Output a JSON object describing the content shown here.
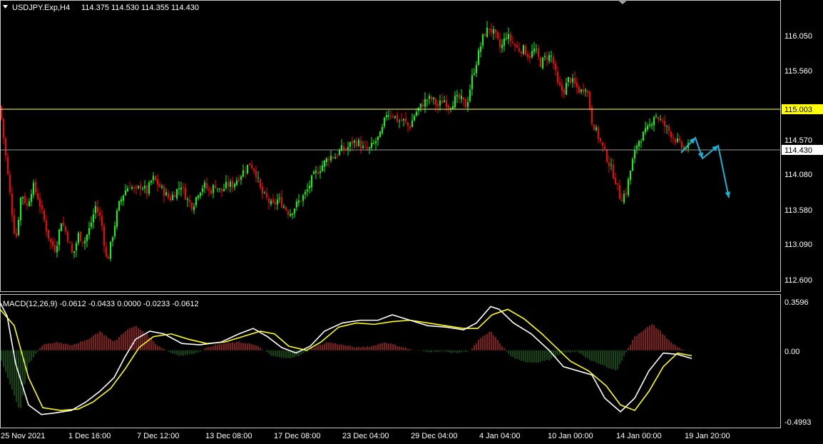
{
  "main_window": {
    "symbol_header": "USDJPY.Exp,H4",
    "ohlc": "114.375 114.530 114.355 114.430",
    "price_axis_labels": [
      "116.050",
      "115.560",
      "115.003",
      "114.570",
      "114.430",
      "114.080",
      "113.580",
      "113.090",
      "112.600"
    ],
    "hline_price": "115.003",
    "last_price": "114.430"
  },
  "macd_window": {
    "header": "MACD(12,26,9) -0.0612 -0.0433 0.0000 -0.0233 -0.0612",
    "axis_labels": [
      "0.3596",
      "0.00",
      "-0.4993"
    ]
  },
  "time_axis": {
    "labels": [
      "25 Nov 2021",
      "1 Dec 16:00",
      "7 Dec 12:00",
      "13 Dec 08:00",
      "17 Dec 08:00",
      "23 Dec 04:00",
      "29 Dec 04:00",
      "4 Jan 04:00",
      "10 Jan 00:00",
      "14 Jan 00:00",
      "19 Jan 20:00"
    ]
  },
  "colors": {
    "bull": "#00ff00",
    "bear": "#ff0000",
    "hline": "#ffff80",
    "macd_line": "#ffffff",
    "signal_line": "#ffff00",
    "hist_pos": "#ff3b3b",
    "hist_neg": "#1f8f1f",
    "forecast_arrow": "#19b4d6"
  },
  "chart_data": {
    "type": "candlestick",
    "symbol": "USDJPY.Exp",
    "timeframe": "H4",
    "ylim": [
      112.45,
      116.45
    ],
    "close_path": [
      [
        0,
        115.0
      ],
      [
        8,
        114.3
      ],
      [
        16,
        113.6
      ],
      [
        22,
        113.1
      ],
      [
        30,
        113.8
      ],
      [
        38,
        113.6
      ],
      [
        46,
        113.9
      ],
      [
        54,
        113.7
      ],
      [
        62,
        113.4
      ],
      [
        70,
        113.1
      ],
      [
        78,
        113.0
      ],
      [
        86,
        113.4
      ],
      [
        94,
        113.2
      ],
      [
        102,
        112.9
      ],
      [
        110,
        113.2
      ],
      [
        118,
        113.1
      ],
      [
        126,
        113.3
      ],
      [
        134,
        113.6
      ],
      [
        142,
        113.4
      ],
      [
        150,
        112.8
      ],
      [
        158,
        113.2
      ],
      [
        166,
        113.6
      ],
      [
        174,
        113.8
      ],
      [
        182,
        113.9
      ],
      [
        190,
        113.8
      ],
      [
        198,
        113.9
      ],
      [
        206,
        113.8
      ],
      [
        214,
        114.0
      ],
      [
        222,
        113.9
      ],
      [
        230,
        113.8
      ],
      [
        238,
        113.7
      ],
      [
        246,
        113.8
      ],
      [
        254,
        113.9
      ],
      [
        262,
        113.7
      ],
      [
        270,
        113.6
      ],
      [
        278,
        113.8
      ],
      [
        286,
        113.9
      ],
      [
        294,
        113.8
      ],
      [
        302,
        113.9
      ],
      [
        310,
        113.8
      ],
      [
        318,
        113.9
      ],
      [
        326,
        113.9
      ],
      [
        334,
        114.0
      ],
      [
        342,
        114.1
      ],
      [
        350,
        114.2
      ],
      [
        358,
        114.1
      ],
      [
        366,
        113.8
      ],
      [
        374,
        113.7
      ],
      [
        382,
        113.6
      ],
      [
        390,
        113.7
      ],
      [
        398,
        113.6
      ],
      [
        406,
        113.5
      ],
      [
        414,
        113.6
      ],
      [
        422,
        113.7
      ],
      [
        430,
        113.8
      ],
      [
        438,
        114.0
      ],
      [
        446,
        114.1
      ],
      [
        454,
        114.2
      ],
      [
        462,
        114.3
      ],
      [
        470,
        114.3
      ],
      [
        478,
        114.4
      ],
      [
        486,
        114.4
      ],
      [
        494,
        114.5
      ],
      [
        502,
        114.5
      ],
      [
        510,
        114.4
      ],
      [
        518,
        114.4
      ],
      [
        526,
        114.5
      ],
      [
        534,
        114.6
      ],
      [
        542,
        114.9
      ],
      [
        550,
        114.9
      ],
      [
        558,
        114.8
      ],
      [
        566,
        114.8
      ],
      [
        574,
        114.7
      ],
      [
        582,
        114.9
      ],
      [
        590,
        115.0
      ],
      [
        598,
        115.1
      ],
      [
        606,
        115.1
      ],
      [
        614,
        115.0
      ],
      [
        622,
        115.1
      ],
      [
        630,
        115.0
      ],
      [
        638,
        115.1
      ],
      [
        646,
        115.1
      ],
      [
        654,
        115.0
      ],
      [
        662,
        115.4
      ],
      [
        670,
        115.7
      ],
      [
        678,
        116.0
      ],
      [
        686,
        116.1
      ],
      [
        694,
        116.0
      ],
      [
        702,
        115.8
      ],
      [
        710,
        116.0
      ],
      [
        718,
        115.9
      ],
      [
        726,
        115.8
      ],
      [
        734,
        115.8
      ],
      [
        742,
        115.7
      ],
      [
        750,
        115.8
      ],
      [
        758,
        115.6
      ],
      [
        766,
        115.7
      ],
      [
        774,
        115.7
      ],
      [
        782,
        115.3
      ],
      [
        790,
        115.2
      ],
      [
        798,
        115.4
      ],
      [
        806,
        115.3
      ],
      [
        814,
        115.2
      ],
      [
        822,
        115.3
      ],
      [
        830,
        114.8
      ],
      [
        838,
        114.6
      ],
      [
        846,
        114.4
      ],
      [
        854,
        114.2
      ],
      [
        862,
        114.0
      ],
      [
        870,
        113.7
      ],
      [
        878,
        113.8
      ],
      [
        886,
        114.2
      ],
      [
        894,
        114.5
      ],
      [
        902,
        114.6
      ],
      [
        910,
        114.7
      ],
      [
        918,
        114.9
      ],
      [
        926,
        114.8
      ],
      [
        934,
        114.7
      ],
      [
        942,
        114.6
      ],
      [
        950,
        114.5
      ],
      [
        958,
        114.4
      ],
      [
        966,
        114.43
      ]
    ],
    "forecast_arrow_path": [
      [
        955,
        114.35
      ],
      [
        975,
        114.56
      ],
      [
        985,
        114.27
      ],
      [
        1007,
        114.45
      ],
      [
        1022,
        113.72
      ]
    ],
    "macd_ylim": [
      -0.55,
      0.38
    ],
    "macd_line_path": [
      [
        0,
        0.35
      ],
      [
        10,
        0.25
      ],
      [
        22,
        -0.1
      ],
      [
        40,
        -0.4
      ],
      [
        58,
        -0.47
      ],
      [
        75,
        -0.46
      ],
      [
        100,
        -0.44
      ],
      [
        120,
        -0.38
      ],
      [
        140,
        -0.3
      ],
      [
        160,
        -0.2
      ],
      [
        175,
        -0.05
      ],
      [
        190,
        0.08
      ],
      [
        210,
        0.14
      ],
      [
        230,
        0.12
      ],
      [
        255,
        0.05
      ],
      [
        280,
        0.04
      ],
      [
        310,
        0.06
      ],
      [
        335,
        0.12
      ],
      [
        355,
        0.16
      ],
      [
        375,
        0.1
      ],
      [
        395,
        0.02
      ],
      [
        415,
        -0.02
      ],
      [
        435,
        0.03
      ],
      [
        455,
        0.14
      ],
      [
        480,
        0.2
      ],
      [
        505,
        0.22
      ],
      [
        530,
        0.22
      ],
      [
        550,
        0.26
      ],
      [
        575,
        0.22
      ],
      [
        600,
        0.18
      ],
      [
        625,
        0.17
      ],
      [
        650,
        0.15
      ],
      [
        668,
        0.2
      ],
      [
        688,
        0.32
      ],
      [
        700,
        0.3
      ],
      [
        720,
        0.2
      ],
      [
        745,
        0.12
      ],
      [
        770,
        0.0
      ],
      [
        790,
        -0.12
      ],
      [
        810,
        -0.15
      ],
      [
        830,
        -0.18
      ],
      [
        848,
        -0.35
      ],
      [
        870,
        -0.45
      ],
      [
        890,
        -0.35
      ],
      [
        910,
        -0.15
      ],
      [
        930,
        -0.02
      ],
      [
        950,
        -0.03
      ],
      [
        970,
        -0.06
      ]
    ],
    "signal_line_path": [
      [
        0,
        0.3
      ],
      [
        20,
        0.18
      ],
      [
        40,
        -0.2
      ],
      [
        60,
        -0.42
      ],
      [
        85,
        -0.44
      ],
      [
        110,
        -0.43
      ],
      [
        130,
        -0.38
      ],
      [
        155,
        -0.28
      ],
      [
        175,
        -0.14
      ],
      [
        195,
        0.02
      ],
      [
        215,
        0.1
      ],
      [
        240,
        0.12
      ],
      [
        265,
        0.08
      ],
      [
        290,
        0.05
      ],
      [
        315,
        0.06
      ],
      [
        340,
        0.1
      ],
      [
        365,
        0.14
      ],
      [
        385,
        0.12
      ],
      [
        405,
        0.03
      ],
      [
        430,
        0.0
      ],
      [
        450,
        0.06
      ],
      [
        475,
        0.17
      ],
      [
        500,
        0.2
      ],
      [
        525,
        0.19
      ],
      [
        550,
        0.21
      ],
      [
        575,
        0.22
      ],
      [
        600,
        0.2
      ],
      [
        625,
        0.18
      ],
      [
        650,
        0.16
      ],
      [
        670,
        0.16
      ],
      [
        690,
        0.26
      ],
      [
        712,
        0.3
      ],
      [
        735,
        0.23
      ],
      [
        760,
        0.12
      ],
      [
        780,
        0.02
      ],
      [
        800,
        -0.08
      ],
      [
        825,
        -0.15
      ],
      [
        850,
        -0.26
      ],
      [
        870,
        -0.4
      ],
      [
        890,
        -0.44
      ],
      [
        910,
        -0.3
      ],
      [
        930,
        -0.12
      ],
      [
        950,
        -0.02
      ],
      [
        970,
        -0.04
      ]
    ],
    "histogram_path": [
      [
        0,
        -0.05
      ],
      [
        18,
        -0.3
      ],
      [
        28,
        -0.45
      ],
      [
        40,
        -0.1
      ],
      [
        60,
        0.04
      ],
      [
        80,
        0.06
      ],
      [
        100,
        0.04
      ],
      [
        120,
        0.07
      ],
      [
        140,
        0.14
      ],
      [
        150,
        0.1
      ],
      [
        160,
        0.06
      ],
      [
        175,
        0.14
      ],
      [
        190,
        0.18
      ],
      [
        205,
        0.12
      ],
      [
        220,
        0.04
      ],
      [
        240,
        -0.02
      ],
      [
        255,
        -0.04
      ],
      [
        275,
        -0.02
      ],
      [
        295,
        0.03
      ],
      [
        315,
        0.05
      ],
      [
        335,
        0.06
      ],
      [
        350,
        0.05
      ],
      [
        365,
        0.02
      ],
      [
        380,
        -0.04
      ],
      [
        400,
        -0.06
      ],
      [
        420,
        -0.04
      ],
      [
        440,
        0.02
      ],
      [
        460,
        0.06
      ],
      [
        480,
        0.04
      ],
      [
        500,
        0.02
      ],
      [
        520,
        0.03
      ],
      [
        540,
        0.06
      ],
      [
        560,
        0.03
      ],
      [
        580,
        0.0
      ],
      [
        600,
        -0.01
      ],
      [
        620,
        -0.01
      ],
      [
        640,
        -0.02
      ],
      [
        660,
        0.0
      ],
      [
        672,
        0.08
      ],
      [
        688,
        0.14
      ],
      [
        700,
        0.06
      ],
      [
        715,
        -0.04
      ],
      [
        730,
        -0.08
      ],
      [
        750,
        -0.09
      ],
      [
        770,
        -0.07
      ],
      [
        790,
        -0.02
      ],
      [
        810,
        -0.01
      ],
      [
        830,
        -0.08
      ],
      [
        850,
        -0.12
      ],
      [
        865,
        -0.15
      ],
      [
        875,
        -0.04
      ],
      [
        890,
        0.1
      ],
      [
        905,
        0.16
      ],
      [
        915,
        0.19
      ],
      [
        928,
        0.13
      ],
      [
        940,
        0.06
      ],
      [
        955,
        0.01
      ],
      [
        970,
        -0.01
      ]
    ]
  }
}
